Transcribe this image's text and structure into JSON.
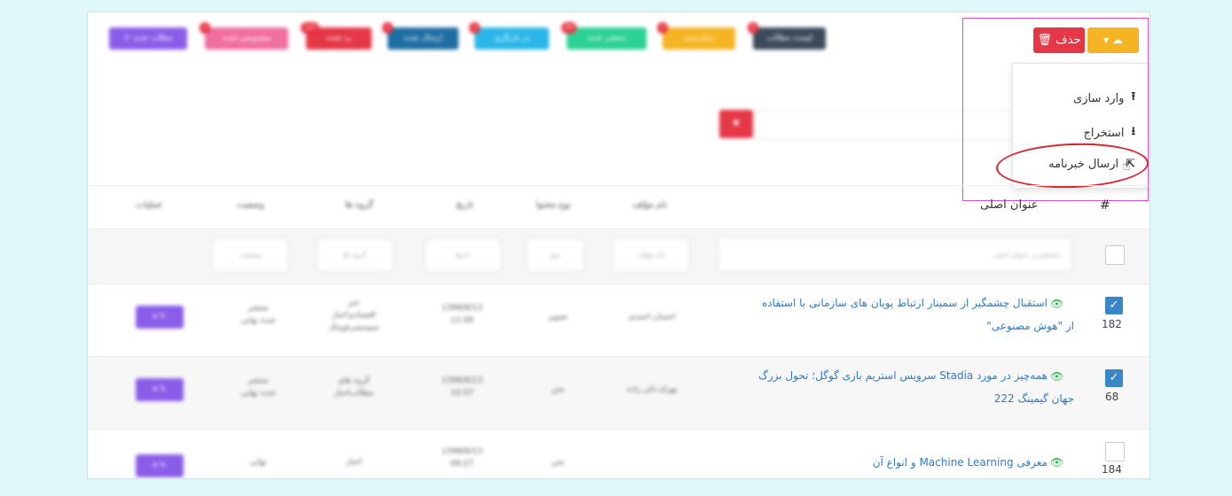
{
  "toolbar": {
    "buttons": [
      {
        "label": "+ مطلب جدید",
        "color": "#8a5de8",
        "badge": ""
      },
      {
        "label": "پیشنویس شده",
        "color": "#f06ea0",
        "badge": "1"
      },
      {
        "label": "رد شده",
        "color": "#e43747",
        "badge": "127"
      },
      {
        "label": "ارسال شده",
        "color": "#1e6ea3",
        "badge": "1"
      },
      {
        "label": "در بازنگری",
        "color": "#2ab6e8",
        "badge": "1"
      },
      {
        "label": "منتشر شده",
        "color": "#2cd196",
        "badge": "99"
      },
      {
        "label": "زمان‌بندی",
        "color": "#f5b423",
        "badge": "1"
      },
      {
        "label": "لیست مطالب",
        "color": "#3b4a5a",
        "badge": "1"
      }
    ],
    "delete_label": "حذف",
    "cloud_label": "▾"
  },
  "dropdown": {
    "items": [
      {
        "label": "وارد سازی",
        "icon": "upload-icon",
        "glyph": "⭱"
      },
      {
        "label": "استخراج",
        "icon": "download-icon",
        "glyph": "⭳"
      },
      {
        "label": "ارسال خبرنامه",
        "icon": "share-icon",
        "glyph": "⇱"
      }
    ]
  },
  "table": {
    "headers": {
      "hash": "#",
      "main_title": "عنوان اصلی",
      "author": "نام مؤلف",
      "content_type": "نوع محتوا",
      "date": "تاریخ",
      "groups": "گروه ها",
      "status": "وضعیت",
      "actions": "عملیات"
    },
    "filters": {
      "main_search": "جستجو در عنوان اصلی",
      "author": "نام مؤلف",
      "type": "نوع",
      "date": "تاریخ",
      "groups": "گروه ها",
      "status": "وضعیت"
    },
    "rows": [
      {
        "id": "182",
        "checked": true,
        "title_line1": "استقبال چشمگیر از سمینار ارتباط پویان های سازمانی با استفاده",
        "title_line2": "از \"هوش مصنوعی\"",
        "author": "احسان احمدی",
        "type": "تصویر",
        "date_line1": "1398/8/13",
        "date_line2": "11:00",
        "groups_line1": "خبر",
        "groups_line2": "اقتصادی‌اخبار",
        "groups_line3": "سیستمی‌فوتبال",
        "status_line1": "منتشر",
        "status_line2": "شده نهایی",
        "action": "▾ ✎"
      },
      {
        "id": "68",
        "checked": true,
        "title_line1": "همه‌چیز در مورد Stadia سرویس استریم بازی گوگل؛ تحول بزرگ",
        "title_line2": "جهان گیمینگ 222",
        "author": "بهرام ذکی زاده",
        "type": "متن",
        "date_line1": "1398/8/13",
        "date_line2": "10:57",
        "groups_line1": "گروه های",
        "groups_line2": "مطالب‌اخبار",
        "groups_line3": "",
        "status_line1": "منتشر",
        "status_line2": "شده نهایی",
        "action": "▾ ✎"
      },
      {
        "id": "184",
        "checked": false,
        "title_line1": "معرفی Machine Learning و انواع آن",
        "title_line2": "",
        "author": "",
        "type": "متن",
        "date_line1": "1398/8/13",
        "date_line2": "09:27",
        "groups_line1": "اخبار",
        "groups_line2": "",
        "groups_line3": "",
        "status_line1": "نهایی",
        "status_line2": "",
        "action": "▾ ✎"
      }
    ]
  }
}
